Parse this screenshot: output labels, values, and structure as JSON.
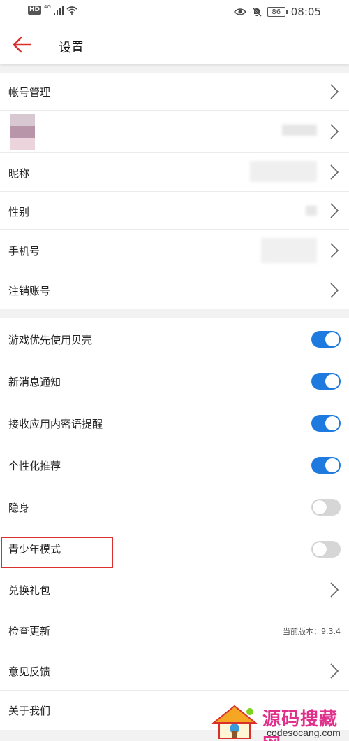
{
  "status_bar": {
    "hd": "HD",
    "network": "4G",
    "battery": "86",
    "time": "08:05",
    "icons": [
      "signal-icon",
      "wifi-icon",
      "eye-icon",
      "mute-bell-icon",
      "battery-icon"
    ]
  },
  "header": {
    "back_icon": "back-arrow-icon",
    "title": "设置",
    "accent": "#d9302c"
  },
  "account_section": {
    "rows": [
      {
        "label": "帐号管理",
        "type": "link"
      },
      {
        "label": "",
        "type": "avatar-link"
      },
      {
        "label": "昵称",
        "type": "link"
      },
      {
        "label": "性别",
        "type": "link"
      },
      {
        "label": "手机号",
        "type": "link"
      },
      {
        "label": "注销账号",
        "type": "link"
      }
    ]
  },
  "settings_section": {
    "rows": [
      {
        "label": "游戏优先使用贝壳",
        "type": "toggle",
        "on": true
      },
      {
        "label": "新消息通知",
        "type": "toggle",
        "on": true
      },
      {
        "label": "接收应用内密语提醒",
        "type": "toggle",
        "on": true
      },
      {
        "label": "个性化推荐",
        "type": "toggle",
        "on": true
      },
      {
        "label": "隐身",
        "type": "toggle",
        "on": false
      },
      {
        "label": "青少年模式",
        "type": "toggle",
        "on": false
      },
      {
        "label": "兑换礼包",
        "type": "link"
      },
      {
        "label": "检查更新",
        "type": "value",
        "value": "当前版本：9.3.4"
      },
      {
        "label": "意见反馈",
        "type": "link"
      },
      {
        "label": "关于我们",
        "type": "link"
      }
    ]
  },
  "watermark": {
    "title": "源码搜藏网",
    "url": "codesocang.com"
  },
  "colors": {
    "toggle_on": "#1f7ae0",
    "toggle_off": "#d6d6d6",
    "highlight": "#d9302c"
  }
}
